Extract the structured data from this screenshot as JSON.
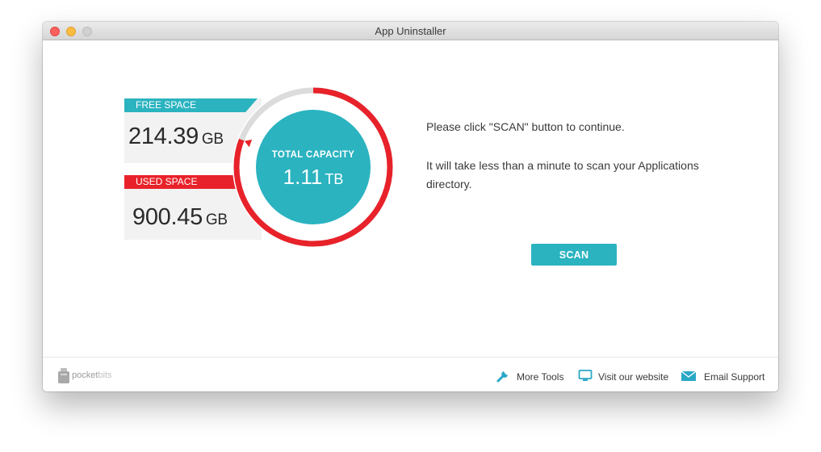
{
  "window": {
    "title": "App Uninstaller",
    "buttons": [
      "close",
      "minimize",
      "zoom"
    ]
  },
  "free_space": {
    "label": "FREE SPACE",
    "value": "214.39",
    "unit": "GB"
  },
  "used_space": {
    "label": "USED SPACE",
    "value": "900.45",
    "unit": "GB"
  },
  "total_capacity": {
    "label": "TOTAL CAPACITY",
    "value": "1.11",
    "unit": "TB"
  },
  "gauge": {
    "used_fraction": 0.8077,
    "used_color": "#e8222a",
    "free_color": "#dcdcdc",
    "center_color": "#2bb3c0"
  },
  "message": {
    "line1": "Please click \"SCAN\" button to continue.",
    "line2": "It will take less than a minute to scan your Applications directory."
  },
  "scan_button": {
    "label": "SCAN"
  },
  "footer": {
    "brand": {
      "name_dark": "pocket",
      "name_light": "bits"
    },
    "links": {
      "more_tools": "More Tools",
      "website": "Visit our website",
      "email": "Email Support"
    }
  },
  "colors": {
    "accent": "#2bb3c0",
    "danger": "#e8222a"
  }
}
